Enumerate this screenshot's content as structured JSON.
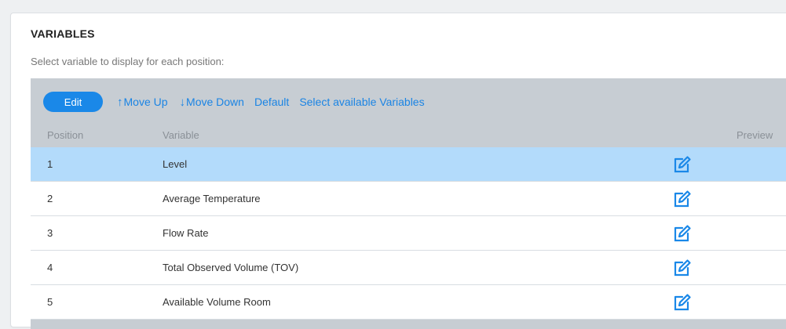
{
  "panel": {
    "title": "VARIABLES",
    "subtitle": "Select variable to display for each position:"
  },
  "toolbar": {
    "edit_label": "Edit",
    "move_up_label": "Move Up",
    "move_down_label": "Move Down",
    "default_label": "Default",
    "select_available_label": "Select available Variables"
  },
  "table": {
    "columns": {
      "position": "Position",
      "variable": "Variable",
      "preview": "Preview"
    },
    "rows": [
      {
        "position": "1",
        "variable": "Level",
        "selected": true
      },
      {
        "position": "2",
        "variable": "Average Temperature",
        "selected": false
      },
      {
        "position": "3",
        "variable": "Flow Rate",
        "selected": false
      },
      {
        "position": "4",
        "variable": "Total Observed Volume (TOV)",
        "selected": false
      },
      {
        "position": "5",
        "variable": "Available Volume Room",
        "selected": false
      }
    ],
    "row_action_icon": "edit-icon"
  },
  "colors": {
    "accent": "#1a88e8",
    "selected_row": "#b3dbfb",
    "grid_header": "#c7cdd3"
  }
}
